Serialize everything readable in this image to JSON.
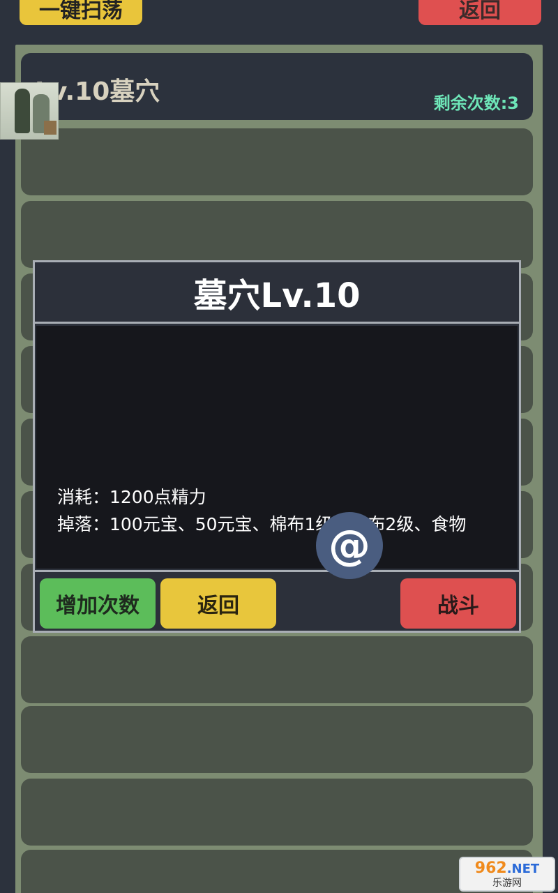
{
  "top_bar": {
    "sweep_label": "一键扫荡",
    "back_label": "返回"
  },
  "list": {
    "selected_title": "Lv.10墓穴",
    "remaining_label": "剩余次数:3"
  },
  "modal": {
    "title": "墓穴Lv.10",
    "cost_line": "消耗：1200点精力",
    "drop_line": "掉落：100元宝、50元宝、棉布1级、棉布2级、食物",
    "add_count_label": "增加次数",
    "back_label": "返回",
    "fight_label": "战斗"
  },
  "float_button": {
    "glyph": "@",
    "icon": "at-icon"
  },
  "watermark": {
    "brand": "962",
    "suffix": ".NET",
    "tagline": "乐游网"
  },
  "colors": {
    "accent_yellow": "#e9c53b",
    "accent_red": "#df5050",
    "accent_green": "#5cbd5a",
    "remaining_text": "#6ee6b8"
  }
}
